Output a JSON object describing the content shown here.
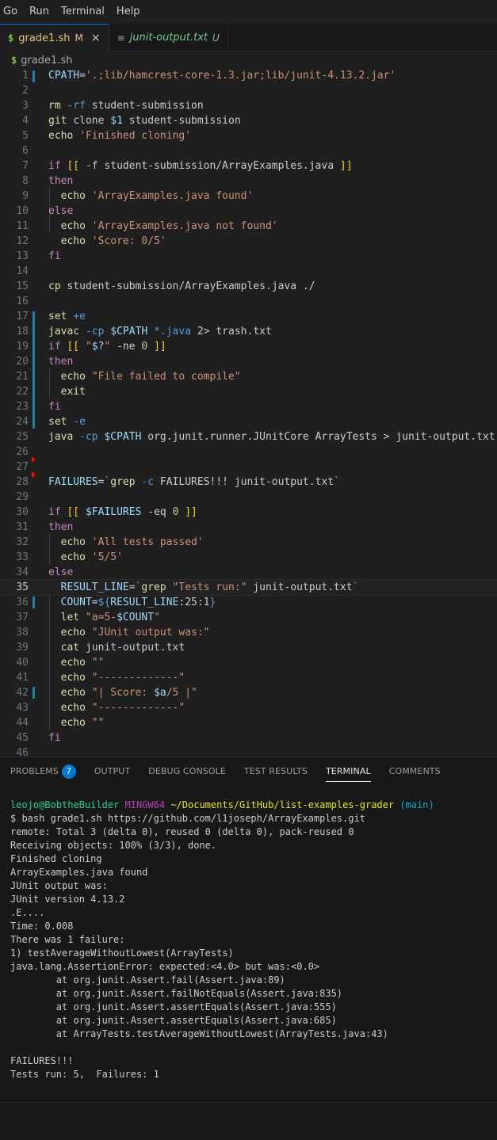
{
  "menu": [
    "Go",
    "Run",
    "Terminal",
    "Help"
  ],
  "tabs": [
    {
      "icon": "$",
      "name": "grade1.sh",
      "badge": "M",
      "close": "×"
    },
    {
      "icon": "≡",
      "name": "junit-output.txt",
      "badge": "U"
    }
  ],
  "breadcrumb": {
    "icon": "$",
    "file": "grade1.sh"
  },
  "editor": {
    "line_numbers": [
      "1",
      "2",
      "3",
      "4",
      "5",
      "6",
      "7",
      "8",
      "9",
      "10",
      "11",
      "12",
      "13",
      "14",
      "15",
      "16",
      "17",
      "18",
      "19",
      "20",
      "21",
      "22",
      "23",
      "24",
      "25",
      "26",
      "27",
      "28",
      "29",
      "30",
      "31",
      "32",
      "33",
      "34",
      "35",
      "36",
      "37",
      "38",
      "39",
      "40",
      "41",
      "42",
      "43",
      "44",
      "45",
      "46"
    ],
    "current_line": "35"
  },
  "panel": {
    "tabs": [
      "PROBLEMS",
      "OUTPUT",
      "DEBUG CONSOLE",
      "TEST RESULTS",
      "TERMINAL",
      "COMMENTS"
    ],
    "problems_count": "7",
    "active_tab": "TERMINAL"
  },
  "terminal": {
    "prompt_user": "leojo@BobtheBuilder",
    "prompt_host": "MINGW64",
    "prompt_path": "~/Documents/GitHub/list-examples-grader",
    "prompt_branch": "(main)",
    "command": "$ bash grade1.sh https://github.com/l1joseph/ArrayExamples.git",
    "output": "remote: Total 3 (delta 0), reused 0 (delta 0), pack-reused 0\nReceiving objects: 100% (3/3), done.\nFinished cloning\nArrayExamples.java found\nJUnit output was:\nJUnit version 4.13.2\n.E....\nTime: 0.008\nThere was 1 failure:\n1) testAverageWithoutLowest(ArrayTests)\njava.lang.AssertionError: expected:<4.0> but was:<0.0>\n        at org.junit.Assert.fail(Assert.java:89)\n        at org.junit.Assert.failNotEquals(Assert.java:835)\n        at org.junit.Assert.assertEquals(Assert.java:555)\n        at org.junit.Assert.assertEquals(Assert.java:685)\n        at ArrayTests.testAverageWithoutLowest(ArrayTests.java:43)\n\nFAILURES!!!\nTests run: 5,  Failures: 1"
  },
  "code": {
    "l1": "CPATH='.;lib/hamcrest-core-1.3.jar;lib/junit-4.13.2.jar'",
    "l3": "rm -rf student-submission",
    "l4": "git clone $1 student-submission",
    "l5": "echo 'Finished cloning'",
    "l7": "if [[ -f student-submission/ArrayExamples.java ]]",
    "l8": "then",
    "l9": "  echo 'ArrayExamples.java found'",
    "l10": "else",
    "l11": "  echo 'ArrayExamples.java not found'",
    "l12": "  echo 'Score: 0/5'",
    "l13": "fi",
    "l15": "cp student-submission/ArrayExamples.java ./",
    "l17": "set +e",
    "l18": "javac -cp $CPATH *.java 2> trash.txt",
    "l19": "if [[ \"$?\" -ne 0 ]]",
    "l20": "then",
    "l21": "  echo \"File failed to compile\"",
    "l22": "  exit",
    "l23": "fi",
    "l24": "set -e",
    "l25": "java -cp $CPATH org.junit.runner.JUnitCore ArrayTests > junit-output.txt",
    "l28": "FAILURES=`grep -c FAILURES!!! junit-output.txt`",
    "l30": "if [[ $FAILURES -eq 0 ]]",
    "l31": "then",
    "l32": "  echo 'All tests passed'",
    "l33": "  echo '5/5'",
    "l34": "else",
    "l35": "  RESULT_LINE=`grep \"Tests run:\" junit-output.txt`",
    "l36": "  COUNT=${RESULT_LINE:25:1}",
    "l37": "  let \"a=5-$COUNT\"",
    "l38": "  echo \"JUnit output was:\"",
    "l39": "  cat junit-output.txt",
    "l40": "  echo \"\"",
    "l41": "  echo \"-------------\"",
    "l42": "  echo \"| Score: $a/5 |\"",
    "l43": "  echo \"-------------\"",
    "l44": "  echo \"\"",
    "l45": "fi"
  }
}
